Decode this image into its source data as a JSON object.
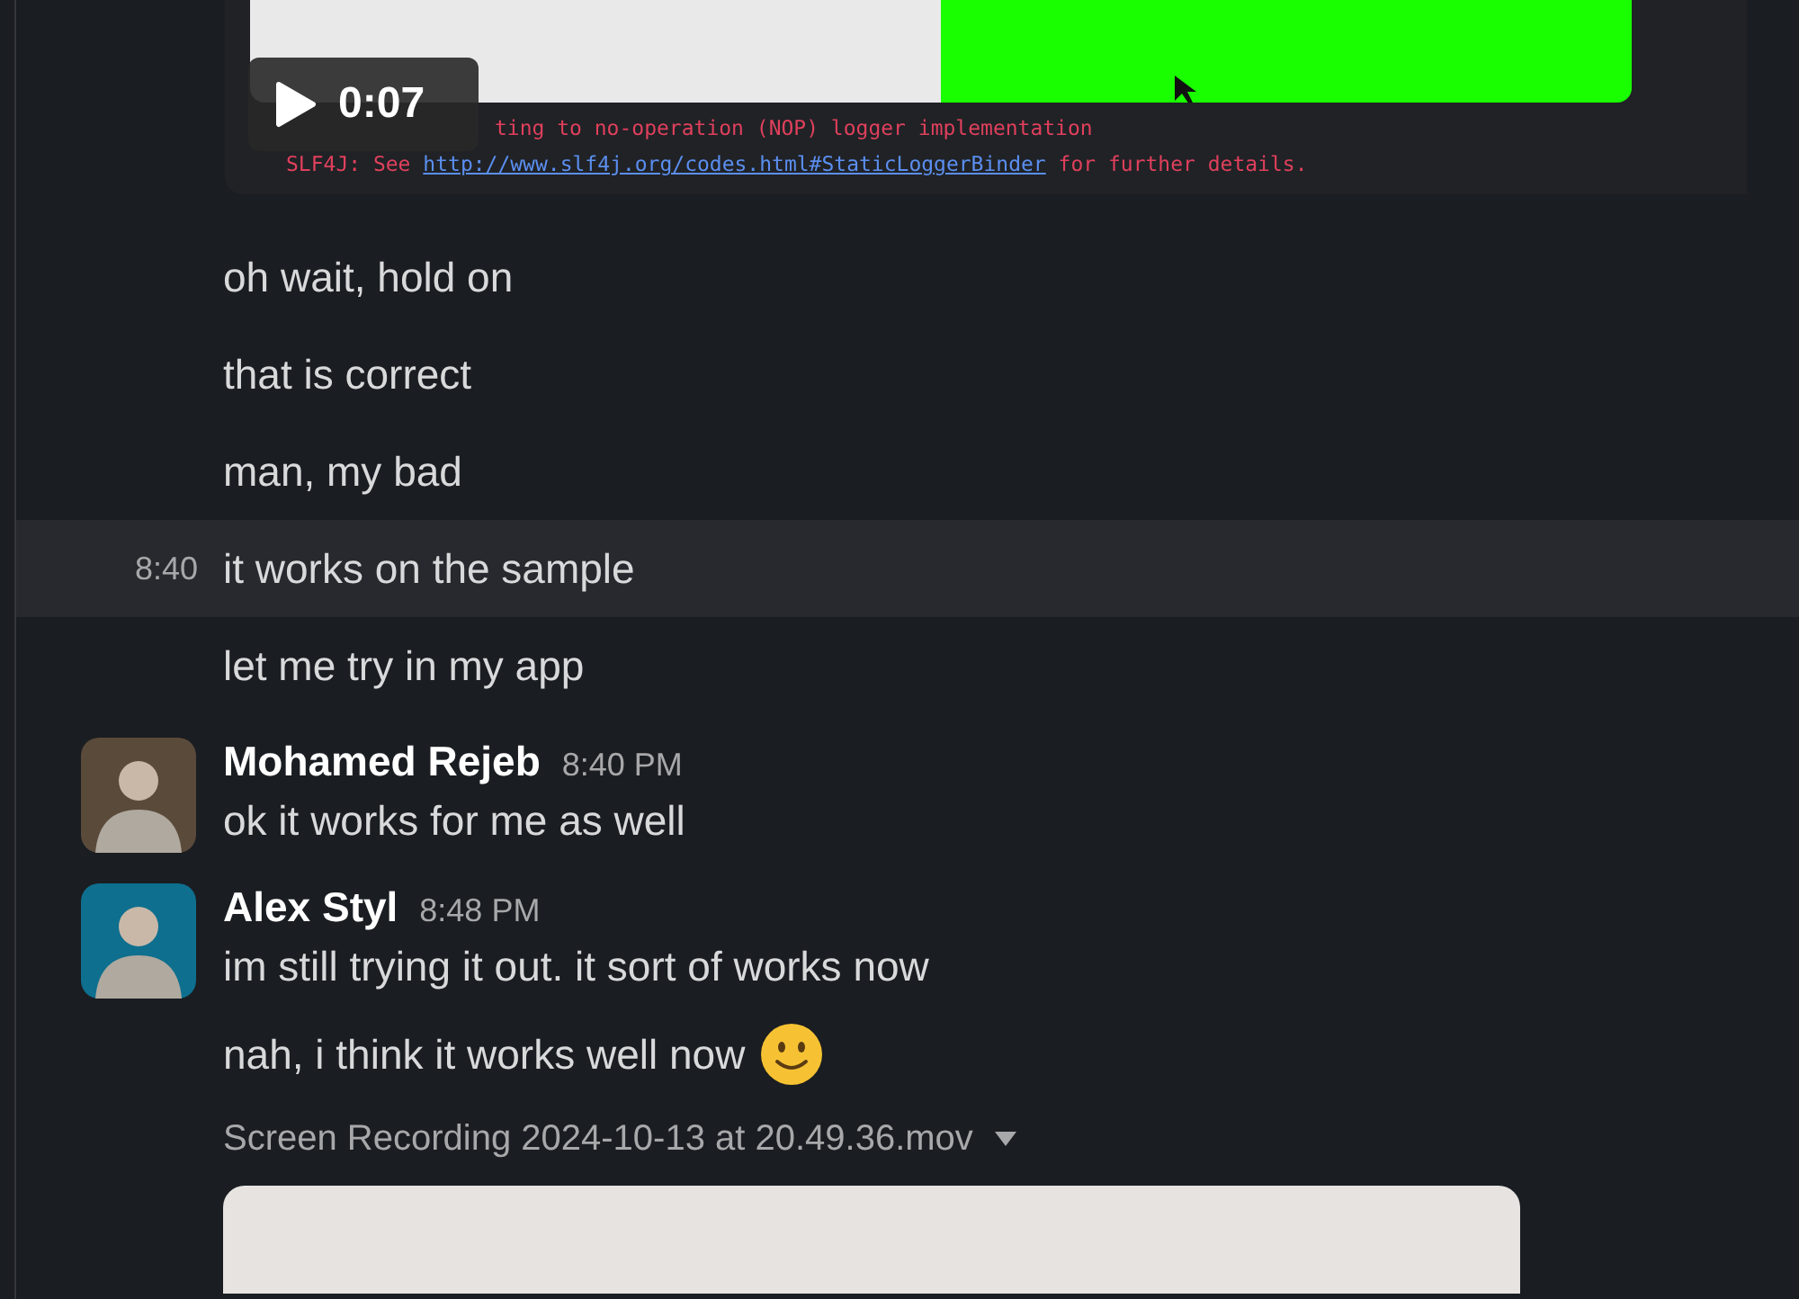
{
  "attachment": {
    "duration": "0:07",
    "log_lines": [
      {
        "prefix": "ting to no-operation (NOP) logger implementation"
      },
      {
        "prefix": "SLF4J: See ",
        "link": "http://www.slf4j.org/codes.html#StaticLoggerBinder",
        "suffix": " for further details."
      }
    ]
  },
  "messages": [
    {
      "kind": "continuation",
      "text": "oh wait, hold on",
      "hovered": false
    },
    {
      "kind": "continuation",
      "text": "that is correct",
      "hovered": false
    },
    {
      "kind": "continuation",
      "text": "man, my bad",
      "hovered": false
    },
    {
      "kind": "continuation",
      "text": "it works on the sample",
      "time": "8:40",
      "hovered": true
    },
    {
      "kind": "continuation",
      "text": "let me try in my app",
      "hovered": false
    },
    {
      "kind": "header",
      "author": "Mohamed Rejeb",
      "time": "8:40 PM",
      "text": "ok it works for me as well"
    },
    {
      "kind": "header",
      "author": "Alex Styl",
      "time": "8:48 PM",
      "text": "im still trying it out. it sort of works now"
    },
    {
      "kind": "continuation",
      "text": "nah, i think it works well now",
      "emoji": true,
      "hovered": false
    },
    {
      "kind": "file",
      "name": "Screen Recording 2024-10-13 at 20.49.36.mov"
    }
  ]
}
